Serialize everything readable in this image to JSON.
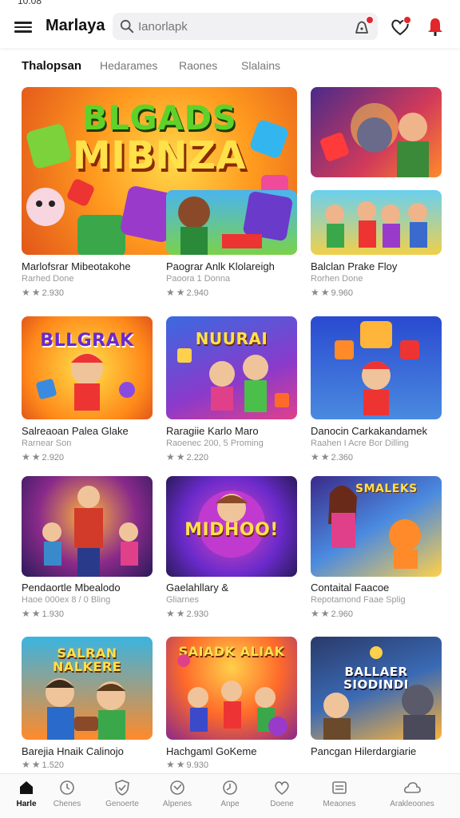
{
  "status": {
    "time": "10:08"
  },
  "app": {
    "title": "Marlaya"
  },
  "search": {
    "placeholder": "Ianorlapk"
  },
  "tabs": [
    {
      "label": "Thalopsan",
      "active": true
    },
    {
      "label": "Hedarames"
    },
    {
      "label": "Raones"
    },
    {
      "label": "Slalains"
    }
  ],
  "hero": {
    "line1": "BLGADS",
    "line2": "MIBNZA"
  },
  "cards": [
    {
      "title": "Marlofsrar Mibeotakohe",
      "sub": "Rarhed Done",
      "rating": "2.930",
      "art": ""
    },
    {
      "title": "Paograr Anlk Klolareigh",
      "sub": "Paoora 1 Donna",
      "rating": "2.940",
      "art": ""
    },
    {
      "title": "Balclan Prake Floy",
      "sub": "Rorhen Done",
      "rating": "9.960",
      "art": ""
    },
    {
      "title": "Salreaoan Palea Glake",
      "sub": "Rarnear Son",
      "rating": "2.920",
      "art": "BLLGRAK"
    },
    {
      "title": "Raragiie Karlo Maro",
      "sub": "Raoenec 200, 5 Proming",
      "rating": "2.220",
      "art": "NUURAI"
    },
    {
      "title": "Danocin Carkakandamek",
      "sub": "Raahen I Acre Bor Dilling",
      "rating": "2.360",
      "art": ""
    },
    {
      "title": "Pendaortle Mbealodo",
      "sub": "Haoe 000ex 8 / 0 Bling",
      "rating": "1.930",
      "art": ""
    },
    {
      "title": "Gaelahllary &",
      "sub": "Gliarnes",
      "rating": "2.930",
      "art": "MIDHOO!"
    },
    {
      "title": "Contaital Faacoe",
      "sub": "Repotamond Faae Splig",
      "rating": "2.960",
      "art": "SMALEKS"
    },
    {
      "title": "Barejia Hnaik Calinojo",
      "sub": "",
      "rating": "1.520",
      "art": "SALRAN NALKERE"
    },
    {
      "title": "Hachgaml GoKeme",
      "sub": "",
      "rating": "9.930",
      "art": "SAIADK ALIAK"
    },
    {
      "title": "Pancgan Hilerdargiarie",
      "sub": "",
      "rating": "",
      "art": "BALLAER SIODINDI"
    }
  ],
  "nav": [
    {
      "label": "Harle",
      "icon": "home-icon",
      "active": true
    },
    {
      "label": "Chenes",
      "icon": "clock-icon"
    },
    {
      "label": "Genoerte",
      "icon": "shield-icon"
    },
    {
      "label": "Alpenes",
      "icon": "gauge-icon"
    },
    {
      "label": "Anpe",
      "icon": "time-icon"
    },
    {
      "label": "Doene",
      "icon": "heart-icon"
    },
    {
      "label": "Meaones",
      "icon": "list-icon"
    },
    {
      "label": "Arakleoones",
      "icon": "cloud-icon"
    }
  ],
  "colors": {
    "accent": "#e3262c",
    "star": "#8a8a8a"
  }
}
